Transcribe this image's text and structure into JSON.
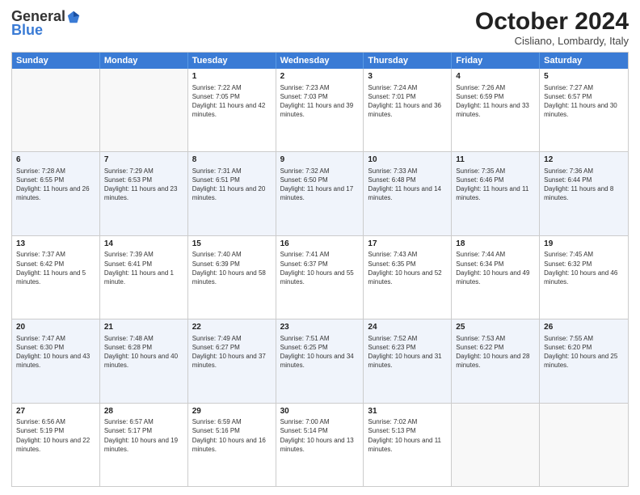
{
  "logo": {
    "general": "General",
    "blue": "Blue"
  },
  "header": {
    "title": "October 2024",
    "subtitle": "Cisliano, Lombardy, Italy"
  },
  "days": [
    "Sunday",
    "Monday",
    "Tuesday",
    "Wednesday",
    "Thursday",
    "Friday",
    "Saturday"
  ],
  "weeks": [
    [
      {
        "day": "",
        "sunrise": "",
        "sunset": "",
        "daylight": "",
        "empty": true
      },
      {
        "day": "",
        "sunrise": "",
        "sunset": "",
        "daylight": "",
        "empty": true
      },
      {
        "day": "1",
        "sunrise": "Sunrise: 7:22 AM",
        "sunset": "Sunset: 7:05 PM",
        "daylight": "Daylight: 11 hours and 42 minutes.",
        "empty": false
      },
      {
        "day": "2",
        "sunrise": "Sunrise: 7:23 AM",
        "sunset": "Sunset: 7:03 PM",
        "daylight": "Daylight: 11 hours and 39 minutes.",
        "empty": false
      },
      {
        "day": "3",
        "sunrise": "Sunrise: 7:24 AM",
        "sunset": "Sunset: 7:01 PM",
        "daylight": "Daylight: 11 hours and 36 minutes.",
        "empty": false
      },
      {
        "day": "4",
        "sunrise": "Sunrise: 7:26 AM",
        "sunset": "Sunset: 6:59 PM",
        "daylight": "Daylight: 11 hours and 33 minutes.",
        "empty": false
      },
      {
        "day": "5",
        "sunrise": "Sunrise: 7:27 AM",
        "sunset": "Sunset: 6:57 PM",
        "daylight": "Daylight: 11 hours and 30 minutes.",
        "empty": false
      }
    ],
    [
      {
        "day": "6",
        "sunrise": "Sunrise: 7:28 AM",
        "sunset": "Sunset: 6:55 PM",
        "daylight": "Daylight: 11 hours and 26 minutes.",
        "empty": false
      },
      {
        "day": "7",
        "sunrise": "Sunrise: 7:29 AM",
        "sunset": "Sunset: 6:53 PM",
        "daylight": "Daylight: 11 hours and 23 minutes.",
        "empty": false
      },
      {
        "day": "8",
        "sunrise": "Sunrise: 7:31 AM",
        "sunset": "Sunset: 6:51 PM",
        "daylight": "Daylight: 11 hours and 20 minutes.",
        "empty": false
      },
      {
        "day": "9",
        "sunrise": "Sunrise: 7:32 AM",
        "sunset": "Sunset: 6:50 PM",
        "daylight": "Daylight: 11 hours and 17 minutes.",
        "empty": false
      },
      {
        "day": "10",
        "sunrise": "Sunrise: 7:33 AM",
        "sunset": "Sunset: 6:48 PM",
        "daylight": "Daylight: 11 hours and 14 minutes.",
        "empty": false
      },
      {
        "day": "11",
        "sunrise": "Sunrise: 7:35 AM",
        "sunset": "Sunset: 6:46 PM",
        "daylight": "Daylight: 11 hours and 11 minutes.",
        "empty": false
      },
      {
        "day": "12",
        "sunrise": "Sunrise: 7:36 AM",
        "sunset": "Sunset: 6:44 PM",
        "daylight": "Daylight: 11 hours and 8 minutes.",
        "empty": false
      }
    ],
    [
      {
        "day": "13",
        "sunrise": "Sunrise: 7:37 AM",
        "sunset": "Sunset: 6:42 PM",
        "daylight": "Daylight: 11 hours and 5 minutes.",
        "empty": false
      },
      {
        "day": "14",
        "sunrise": "Sunrise: 7:39 AM",
        "sunset": "Sunset: 6:41 PM",
        "daylight": "Daylight: 11 hours and 1 minute.",
        "empty": false
      },
      {
        "day": "15",
        "sunrise": "Sunrise: 7:40 AM",
        "sunset": "Sunset: 6:39 PM",
        "daylight": "Daylight: 10 hours and 58 minutes.",
        "empty": false
      },
      {
        "day": "16",
        "sunrise": "Sunrise: 7:41 AM",
        "sunset": "Sunset: 6:37 PM",
        "daylight": "Daylight: 10 hours and 55 minutes.",
        "empty": false
      },
      {
        "day": "17",
        "sunrise": "Sunrise: 7:43 AM",
        "sunset": "Sunset: 6:35 PM",
        "daylight": "Daylight: 10 hours and 52 minutes.",
        "empty": false
      },
      {
        "day": "18",
        "sunrise": "Sunrise: 7:44 AM",
        "sunset": "Sunset: 6:34 PM",
        "daylight": "Daylight: 10 hours and 49 minutes.",
        "empty": false
      },
      {
        "day": "19",
        "sunrise": "Sunrise: 7:45 AM",
        "sunset": "Sunset: 6:32 PM",
        "daylight": "Daylight: 10 hours and 46 minutes.",
        "empty": false
      }
    ],
    [
      {
        "day": "20",
        "sunrise": "Sunrise: 7:47 AM",
        "sunset": "Sunset: 6:30 PM",
        "daylight": "Daylight: 10 hours and 43 minutes.",
        "empty": false
      },
      {
        "day": "21",
        "sunrise": "Sunrise: 7:48 AM",
        "sunset": "Sunset: 6:28 PM",
        "daylight": "Daylight: 10 hours and 40 minutes.",
        "empty": false
      },
      {
        "day": "22",
        "sunrise": "Sunrise: 7:49 AM",
        "sunset": "Sunset: 6:27 PM",
        "daylight": "Daylight: 10 hours and 37 minutes.",
        "empty": false
      },
      {
        "day": "23",
        "sunrise": "Sunrise: 7:51 AM",
        "sunset": "Sunset: 6:25 PM",
        "daylight": "Daylight: 10 hours and 34 minutes.",
        "empty": false
      },
      {
        "day": "24",
        "sunrise": "Sunrise: 7:52 AM",
        "sunset": "Sunset: 6:23 PM",
        "daylight": "Daylight: 10 hours and 31 minutes.",
        "empty": false
      },
      {
        "day": "25",
        "sunrise": "Sunrise: 7:53 AM",
        "sunset": "Sunset: 6:22 PM",
        "daylight": "Daylight: 10 hours and 28 minutes.",
        "empty": false
      },
      {
        "day": "26",
        "sunrise": "Sunrise: 7:55 AM",
        "sunset": "Sunset: 6:20 PM",
        "daylight": "Daylight: 10 hours and 25 minutes.",
        "empty": false
      }
    ],
    [
      {
        "day": "27",
        "sunrise": "Sunrise: 6:56 AM",
        "sunset": "Sunset: 5:19 PM",
        "daylight": "Daylight: 10 hours and 22 minutes.",
        "empty": false
      },
      {
        "day": "28",
        "sunrise": "Sunrise: 6:57 AM",
        "sunset": "Sunset: 5:17 PM",
        "daylight": "Daylight: 10 hours and 19 minutes.",
        "empty": false
      },
      {
        "day": "29",
        "sunrise": "Sunrise: 6:59 AM",
        "sunset": "Sunset: 5:16 PM",
        "daylight": "Daylight: 10 hours and 16 minutes.",
        "empty": false
      },
      {
        "day": "30",
        "sunrise": "Sunrise: 7:00 AM",
        "sunset": "Sunset: 5:14 PM",
        "daylight": "Daylight: 10 hours and 13 minutes.",
        "empty": false
      },
      {
        "day": "31",
        "sunrise": "Sunrise: 7:02 AM",
        "sunset": "Sunset: 5:13 PM",
        "daylight": "Daylight: 10 hours and 11 minutes.",
        "empty": false
      },
      {
        "day": "",
        "sunrise": "",
        "sunset": "",
        "daylight": "",
        "empty": true
      },
      {
        "day": "",
        "sunrise": "",
        "sunset": "",
        "daylight": "",
        "empty": true
      }
    ]
  ]
}
